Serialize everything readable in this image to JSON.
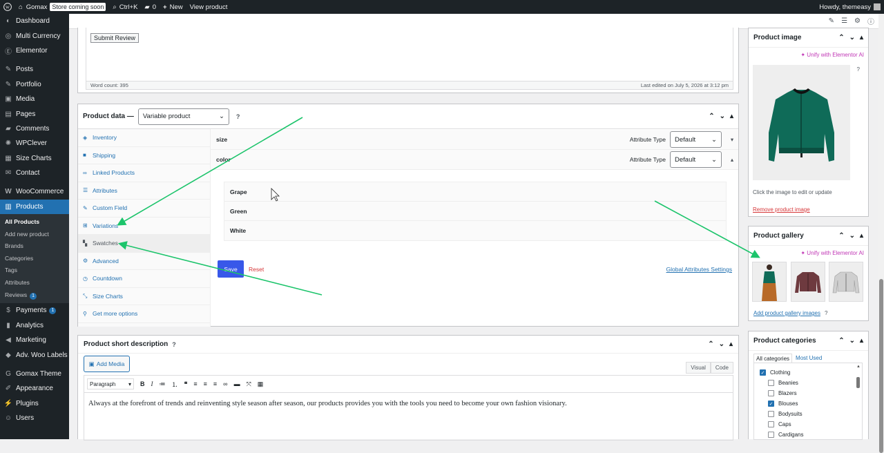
{
  "adminbar": {
    "site_name": "Gomax",
    "store_badge": "Store coming soon",
    "search_shortcut": "Ctrl+K",
    "comments_count": "0",
    "new_label": "New",
    "view_product": "View product",
    "howdy": "Howdy, themeasy"
  },
  "menu": {
    "dashboard": "Dashboard",
    "multi_currency": "Multi Currency",
    "elementor": "Elementor",
    "posts": "Posts",
    "portfolio": "Portfolio",
    "media": "Media",
    "pages": "Pages",
    "comments": "Comments",
    "wpclever": "WPClever",
    "size_charts": "Size Charts",
    "contact": "Contact",
    "woocommerce": "WooCommerce",
    "products": "Products",
    "sub_all_products": "All Products",
    "sub_add_new": "Add new product",
    "sub_brands": "Brands",
    "sub_categories": "Categories",
    "sub_tags": "Tags",
    "sub_attributes": "Attributes",
    "sub_reviews": "Reviews",
    "reviews_badge": "1",
    "payments": "Payments",
    "payments_badge": "1",
    "analytics": "Analytics",
    "marketing": "Marketing",
    "adv_woo_labels": "Adv. Woo Labels",
    "gomax_theme": "Gomax Theme",
    "appearance": "Appearance",
    "plugins": "Plugins",
    "users": "Users"
  },
  "editor": {
    "submit_review": "Submit Review",
    "word_count": "Word count: 395",
    "last_edited": "Last edited on July 5, 2026 at 3:12 pm"
  },
  "product_data": {
    "label": "Product data —",
    "type": "Variable product",
    "tabs": {
      "inventory": "Inventory",
      "shipping": "Shipping",
      "linked": "Linked Products",
      "attributes": "Attributes",
      "custom_field": "Custom Field",
      "variations": "Variations",
      "swatches": "Swatches",
      "advanced": "Advanced",
      "countdown": "Countdown",
      "size_charts": "Size Charts",
      "more": "Get more options"
    },
    "attr_size": "size",
    "attr_color": "color",
    "attribute_type_label": "Attribute Type",
    "attribute_type_value": "Default",
    "terms": {
      "grape": "Grape",
      "green": "Green",
      "white": "White"
    },
    "save": "Save",
    "reset": "Reset",
    "global_settings": "Global Attributes Settings"
  },
  "short_desc": {
    "title": "Product short description",
    "add_media": "Add Media",
    "visual": "Visual",
    "code": "Code",
    "paragraph": "Paragraph",
    "content": "Always at the forefront of trends and reinventing style season after season, our products provides you with the tools you need to become your own fashion visionary."
  },
  "product_image": {
    "title": "Product image",
    "unify": "Unify with Elementor AI",
    "click_hint": "Click the image to edit or update",
    "remove": "Remove product image"
  },
  "gallery": {
    "title": "Product gallery",
    "unify": "Unify with Elementor AI",
    "add": "Add product gallery images"
  },
  "categories": {
    "title": "Product categories",
    "tab_all": "All categories",
    "tab_most": "Most Used",
    "items": {
      "clothing": "Clothing",
      "beanies": "Beanies",
      "blazers": "Blazers",
      "blouses": "Blouses",
      "bodysuits": "Bodysuits",
      "caps": "Caps",
      "cardigans": "Cardigans"
    }
  },
  "colors": {
    "admin_dark": "#1d2327",
    "accent": "#2271b1",
    "save_blue": "#3858e9",
    "arrow_green": "#1cc46b",
    "jacket_green": "#0f6b58"
  }
}
